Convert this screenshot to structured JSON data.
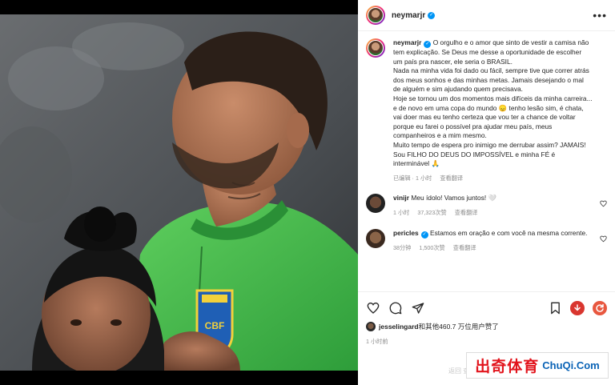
{
  "header": {
    "username": "neymarjr",
    "verified_mark": "✓"
  },
  "caption": {
    "username": "neymarjr",
    "text": "O orgulho e o amor que sinto de vestir a camisa não tem explicação. Se Deus me desse a oportunidade de escolher um país pra nascer, ele seria o BRASIL.\nNada na minha vida foi dado ou fácil, sempre tive que correr atrás dos meus sonhos e das minhas metas. Jamais desejando o mal de alguém e sim ajudando quem precisava.\nHoje se tornou um dos momentos mais difíceis da minha carreira... e de novo em uma copa do mundo 😞 tenho lesão sim, é chata, vai doer mas eu tenho certeza que vou ter a chance de voltar porque eu farei o possível pra ajudar meu país, meus companheiros e a mim mesmo.\nMuito tempo de espera pro inimigo me derrubar assim? JAMAIS!\nSou FILHO DO DEUS DO IMPOSSÍVEL e minha FÉ é interminável 🙏",
    "edited": "已编辑 · 1 小时",
    "translate": "查看翻译"
  },
  "comments": [
    {
      "username": "vinijr",
      "text": "Meu ídolo! Vamos juntos! 🤍",
      "time": "1 小时",
      "likes": "37,323次赞",
      "translate": "查看翻译"
    },
    {
      "username": "pericles",
      "text": "Estamos em oração e com você na mesma corrente.",
      "time": "38分钟",
      "likes": "1,500次赞",
      "translate": "查看翻译"
    }
  ],
  "likes_line": {
    "user": "jesselingard",
    "text": "和其他460.7 万位用户赞了"
  },
  "timestamp": "1 小时前",
  "watermark": {
    "cn": "出奇体育",
    "en": "ChuQi.Com",
    "ghost": "返回 查看"
  },
  "colors": {
    "accent": "#0095f6",
    "jersey": "#3bb34a",
    "brand_red": "#e2151d"
  },
  "icons": [
    "more-icon",
    "heart-icon",
    "comment-icon",
    "share-icon",
    "bookmark-icon",
    "download-icon",
    "refresh-icon"
  ]
}
